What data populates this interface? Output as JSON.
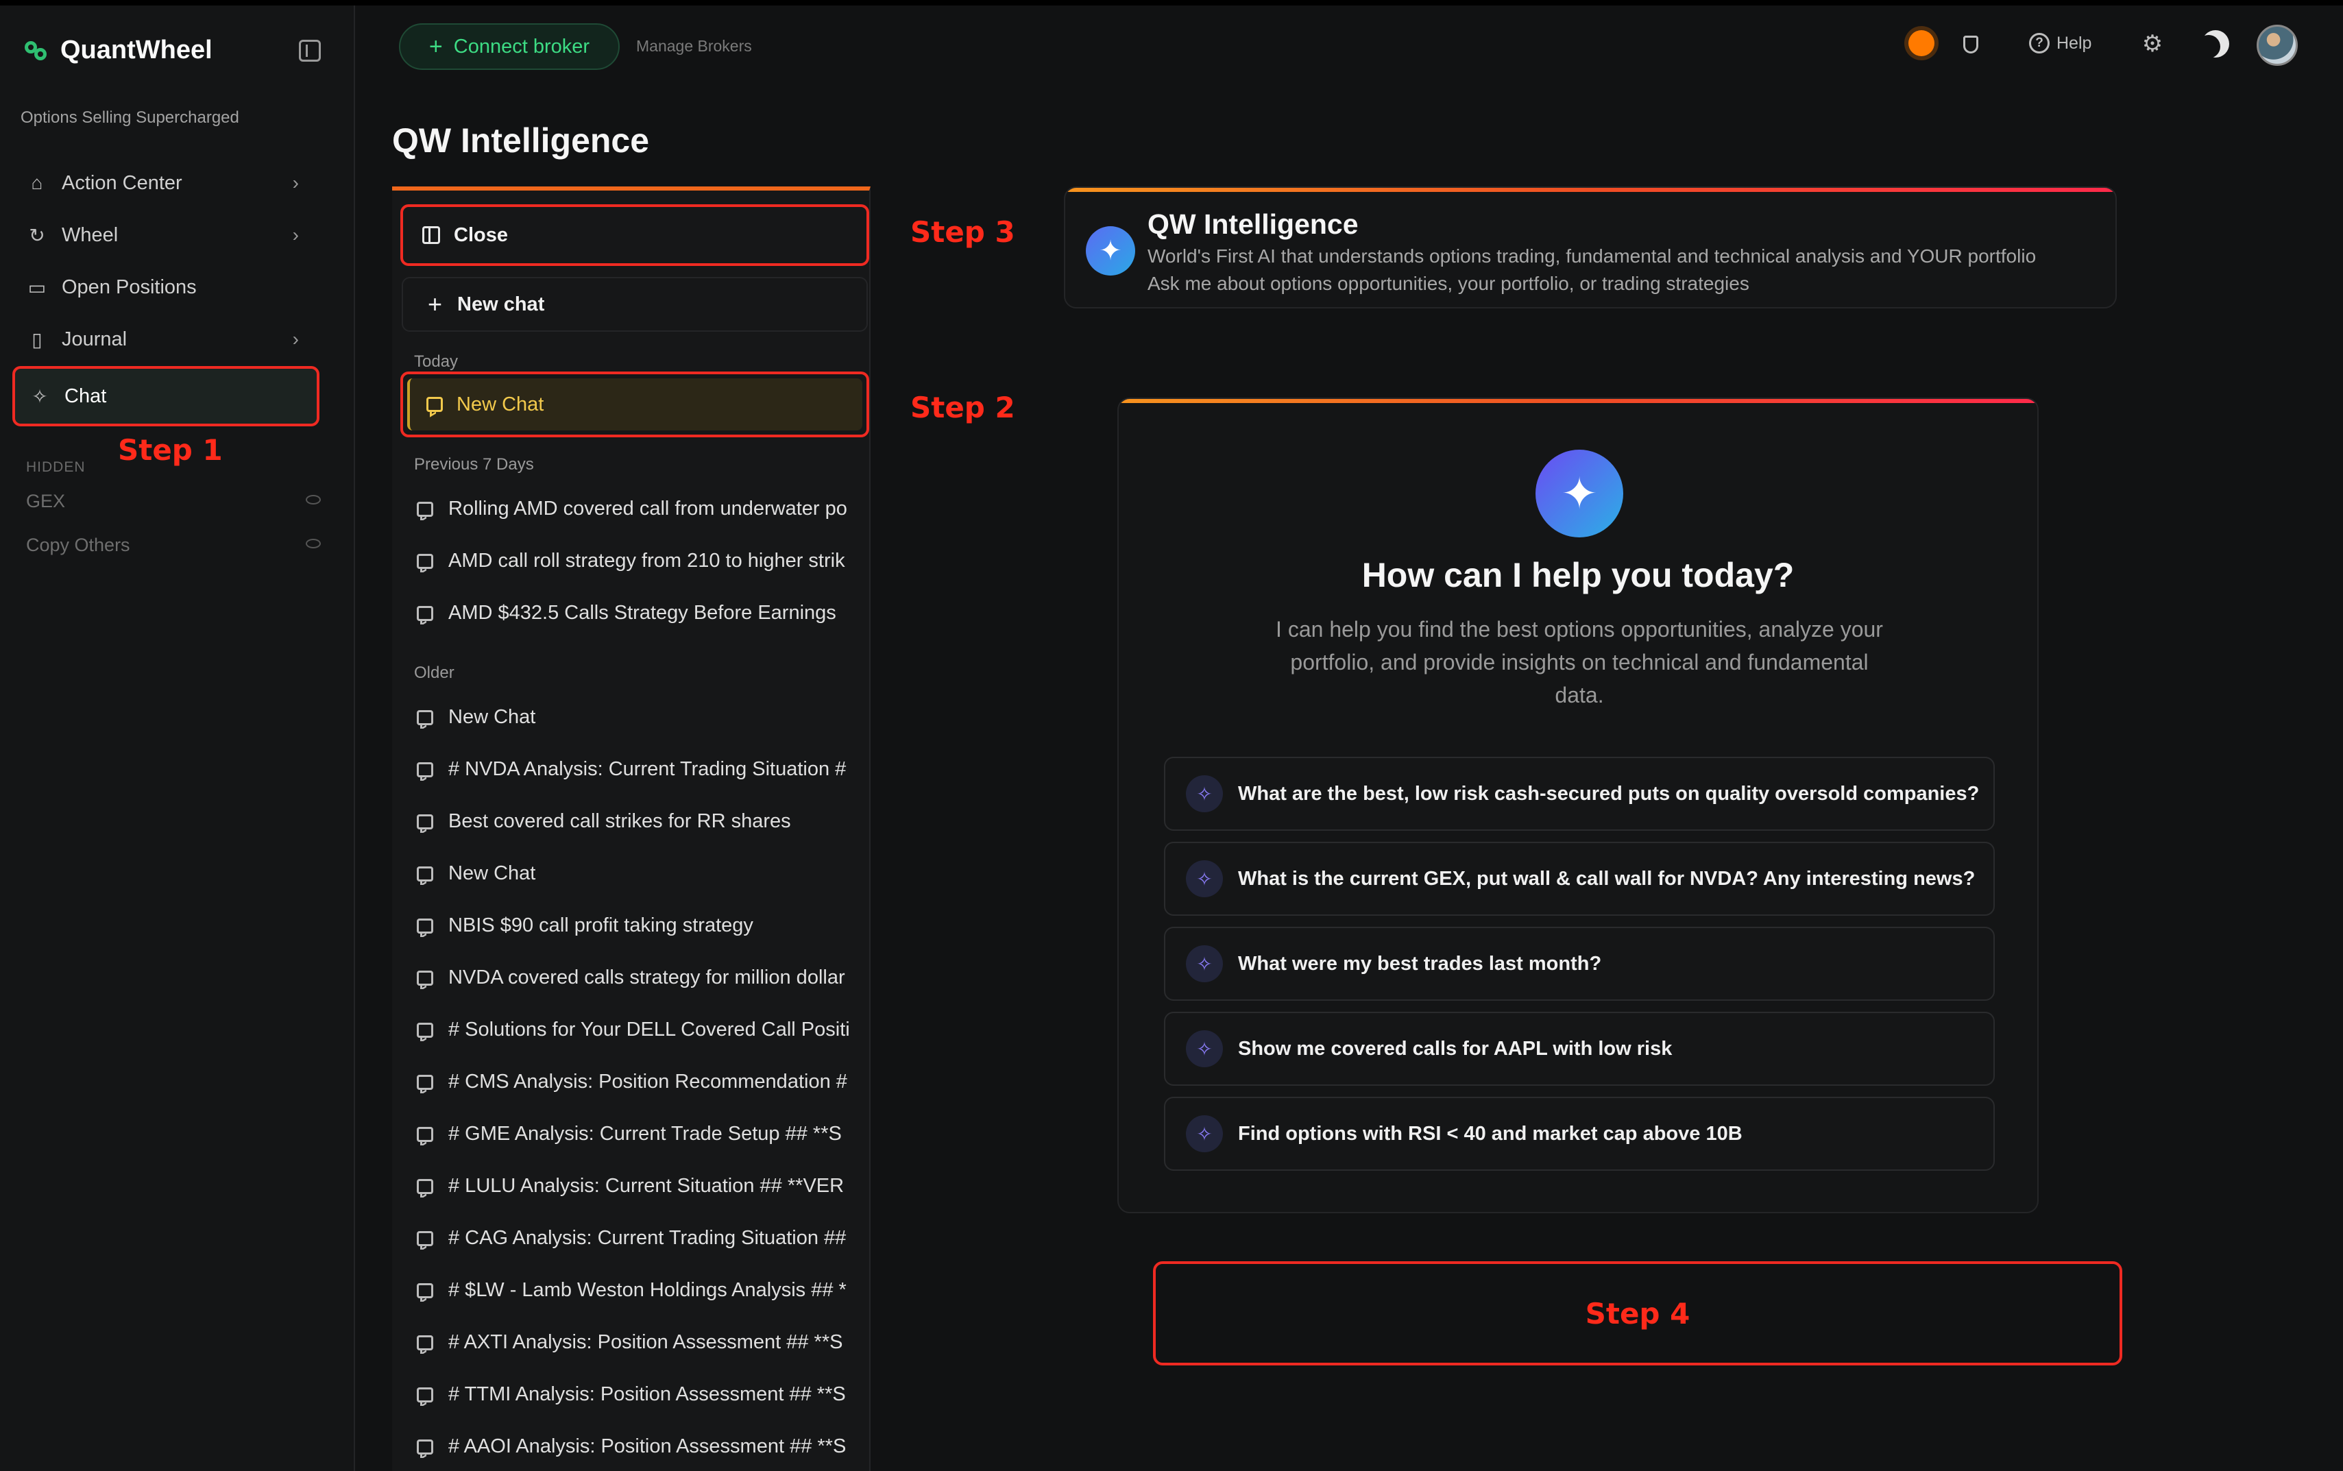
{
  "app": {
    "name": "QuantWheel",
    "tagline": "Options Selling Supercharged"
  },
  "sidebar": {
    "items": [
      {
        "label": "Action Center",
        "icon": "home-icon",
        "chevron": true
      },
      {
        "label": "Wheel",
        "icon": "refresh-icon",
        "chevron": true
      },
      {
        "label": "Open Positions",
        "icon": "briefcase-icon",
        "chevron": false
      },
      {
        "label": "Journal",
        "icon": "book-icon",
        "chevron": true
      },
      {
        "label": "Chat",
        "icon": "sparkle-icon",
        "chevron": false,
        "active": true
      }
    ],
    "hidden_label": "HIDDEN",
    "hidden_items": [
      "GEX",
      "Copy Others"
    ]
  },
  "steps": {
    "step1": "Step 1",
    "step2": "Step 2",
    "step3": "Step 3",
    "step4": "Step 4"
  },
  "header": {
    "connect_label": "Connect broker",
    "manage_label": "Manage Brokers",
    "help_label": "Help",
    "status_color": "#ff7a00"
  },
  "page": {
    "title": "QW Intelligence"
  },
  "history": {
    "close_label": "Close",
    "new_chat_label": "New chat",
    "today_label": "Today",
    "today_items": [
      "New Chat"
    ],
    "prev_label": "Previous 7 Days",
    "prev_items": [
      "Rolling AMD covered call from underwater po",
      "AMD call roll strategy from 210 to higher strik",
      "AMD $432.5 Calls Strategy Before Earnings"
    ],
    "older_label": "Older",
    "older_items": [
      "New Chat",
      "# NVDA Analysis: Current Trading Situation #",
      "Best covered call strikes for RR shares",
      "New Chat",
      "NBIS $90 call profit taking strategy",
      "NVDA covered calls strategy for million dollar",
      "# Solutions for Your DELL Covered Call Positi",
      "# CMS Analysis: Position Recommendation #",
      "# GME Analysis: Current Trade Setup ## **S",
      "# LULU Analysis: Current Situation ## **VER",
      "# CAG Analysis: Current Trading Situation ##",
      "# $LW - Lamb Weston Holdings Analysis ## *",
      "# AXTI Analysis: Position Assessment ## **S",
      "# TTMI Analysis: Position Assessment ## **S",
      "# AAOI Analysis: Position Assessment ## **S"
    ]
  },
  "intro": {
    "title": "QW Intelligence",
    "subtitle": "World's First AI that understands options trading, fundamental and technical analysis and YOUR portfolio",
    "subtitle2": "Ask me about options opportunities, your portfolio, or trading strategies"
  },
  "help_card": {
    "title": "How can I help you today?",
    "description": "I can help you find the best options opportunities, analyze your portfolio, and provide insights on technical and fundamental data.",
    "prompts": [
      "What are the best, low risk cash-secured puts on quality oversold companies?",
      "What is the current GEX, put wall & call wall for NVDA? Any interesting news?",
      "What were my best trades last month?",
      "Show me covered calls for AAPL with low risk",
      "Find options with RSI < 40 and market cap above 10B"
    ]
  },
  "colors": {
    "accent": "#3ddc84",
    "highlight": "#ef2a22",
    "active_chat": "#f2c94c"
  }
}
